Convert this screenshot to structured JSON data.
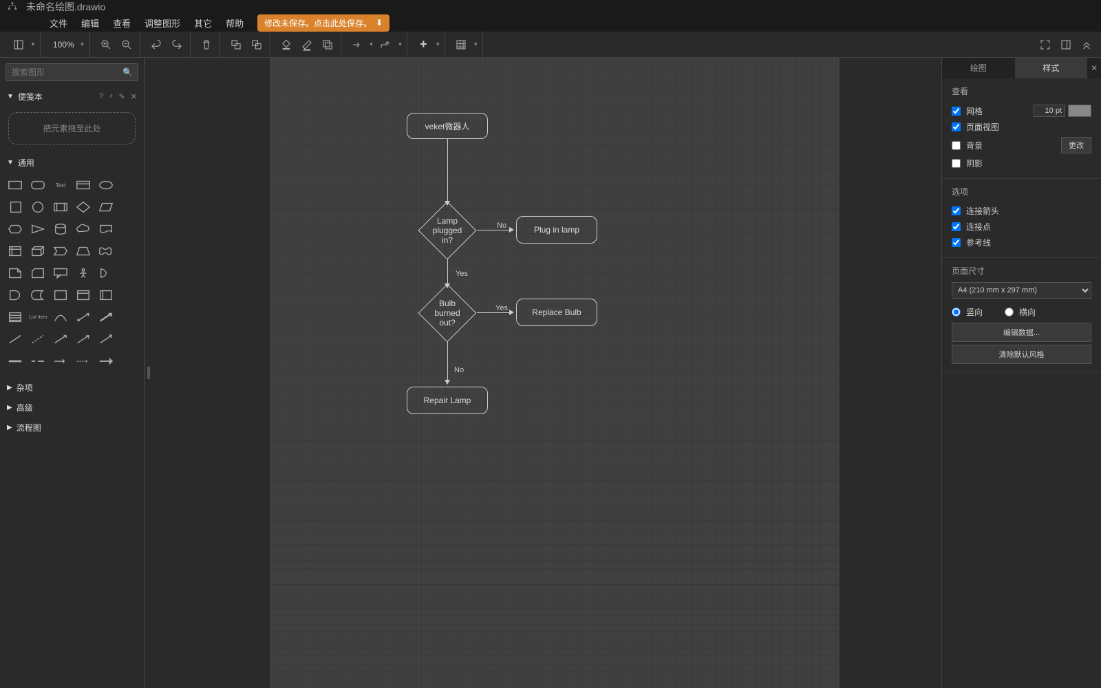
{
  "title": "未命名绘图.drawio",
  "menus": {
    "file": "文件",
    "edit": "编辑",
    "view": "查看",
    "arrange": "调整图形",
    "other": "其它",
    "help": "帮助"
  },
  "save_banner": "修改未保存。点击此处保存。",
  "zoom": "100%",
  "search_placeholder": "搜索图形",
  "sections": {
    "scratchpad": "便笺本",
    "dropzone": "把元素拖至此处",
    "general": "通用",
    "misc": "杂项",
    "advanced": "高级",
    "flowchart": "流程图"
  },
  "nodes": {
    "start": "veket微器人",
    "d1_l1": "Lamp",
    "d1_l2": "plugged in?",
    "plug": "Plug in lamp",
    "d2_l1": "Bulb",
    "d2_l2": "burned out?",
    "replace": "Replace Bulb",
    "repair": "Repair Lamp"
  },
  "labels": {
    "no": "No",
    "yes": "Yes"
  },
  "rp": {
    "tab_diagram": "绘图",
    "tab_style": "样式",
    "view_title": "查看",
    "grid": "网格",
    "pageview": "页面视图",
    "background": "背景",
    "shadow": "阴影",
    "change": "更改",
    "grid_size": "10 pt",
    "options_title": "选项",
    "conn_arrows": "连接箭头",
    "conn_points": "连接点",
    "guides": "参考线",
    "page_size_title": "页面尺寸",
    "paper": "A4 (210 mm x 297 mm)",
    "portrait": "竖向",
    "landscape": "横向",
    "edit_data": "编辑数据...",
    "clear_style": "清除默认风格"
  }
}
